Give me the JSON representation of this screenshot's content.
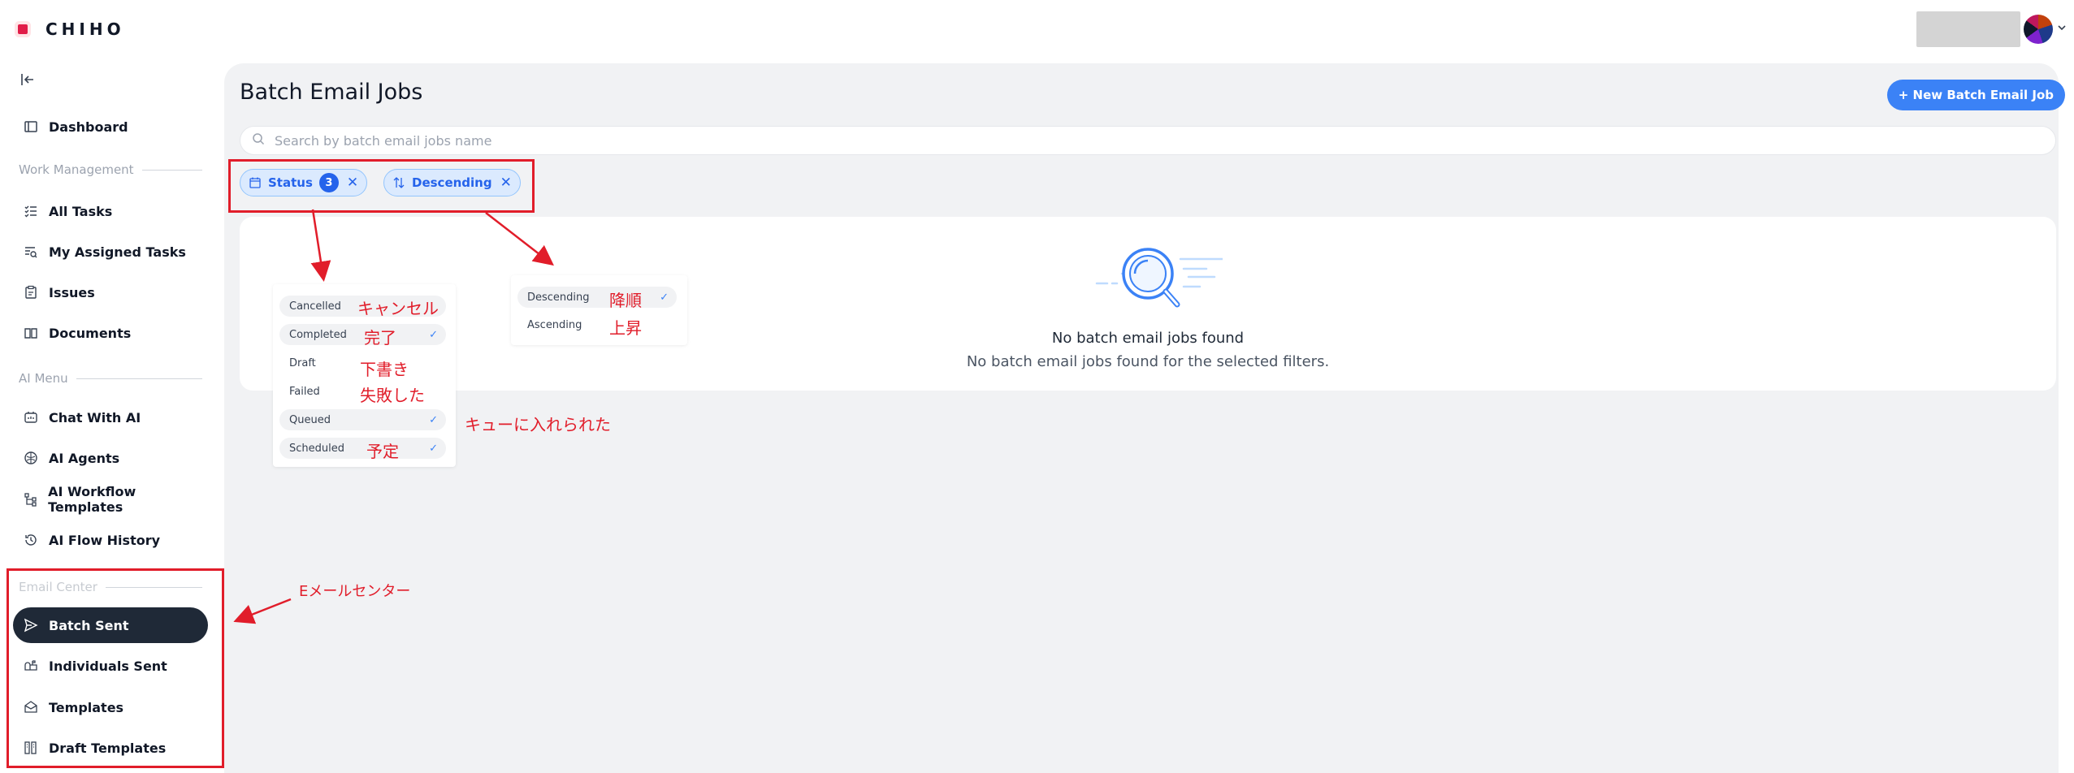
{
  "app": {
    "logo_text": "CHIHO"
  },
  "sidebar": {
    "items_top": [
      {
        "label": "Dashboard"
      }
    ],
    "sections": {
      "work": "Work Management",
      "ai": "AI Menu",
      "email": "Email Center"
    },
    "work_items": [
      {
        "label": "All Tasks"
      },
      {
        "label": "My Assigned Tasks"
      },
      {
        "label": "Issues"
      },
      {
        "label": "Documents"
      }
    ],
    "ai_items": [
      {
        "label": "Chat With AI"
      },
      {
        "label": "AI Agents"
      },
      {
        "label": "AI Workflow Templates"
      },
      {
        "label": "AI Flow History"
      }
    ],
    "email_items": [
      {
        "label": "Batch Sent"
      },
      {
        "label": "Individuals Sent"
      },
      {
        "label": "Templates"
      },
      {
        "label": "Draft Templates"
      }
    ]
  },
  "main": {
    "title": "Batch Email Jobs",
    "new_button": "+ New Batch Email Job",
    "search_placeholder": "Search by batch email jobs name",
    "filters": {
      "status_label": "Status",
      "status_count": "3",
      "sort_label": "Descending"
    },
    "empty": {
      "title": "No batch email jobs found",
      "subtitle": "No batch email jobs found for the selected filters."
    }
  },
  "status_popup": {
    "options": [
      {
        "label": "Cancelled",
        "jp": "キャンセル",
        "checked": false
      },
      {
        "label": "Completed",
        "jp": "完了",
        "checked": true
      },
      {
        "label": "Draft",
        "jp": "下書き",
        "checked": false
      },
      {
        "label": "Failed",
        "jp": "失敗した",
        "checked": false
      },
      {
        "label": "Queued",
        "jp": "キューに入れられた",
        "checked": true
      },
      {
        "label": "Scheduled",
        "jp": "予定",
        "checked": true
      }
    ]
  },
  "sort_popup": {
    "options": [
      {
        "label": "Descending",
        "jp": "降順",
        "checked": true
      },
      {
        "label": "Ascending",
        "jp": "上昇",
        "checked": false
      }
    ]
  },
  "annotations": {
    "email_center_jp": "Eメールセンター"
  },
  "colors": {
    "accent": "#3b82f6",
    "annotation": "#e11d2a",
    "active_nav": "#1f2937"
  }
}
